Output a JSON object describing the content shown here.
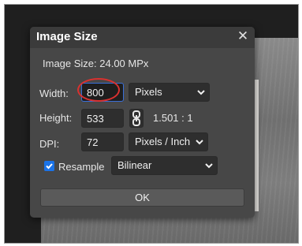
{
  "dialog": {
    "title": "Image Size",
    "close_symbol": "✕",
    "info": "Image Size: 24.00 MPx",
    "width": {
      "label": "Width:",
      "value": "800",
      "unit": "Pixels"
    },
    "height": {
      "label": "Height:",
      "value": "533",
      "ratio": "1.501 : 1"
    },
    "dpi": {
      "label": "DPI:",
      "value": "72",
      "unit": "Pixels / Inch"
    },
    "resample": {
      "label": "Resample",
      "checked": true,
      "method": "Bilinear"
    },
    "ok_label": "OK"
  },
  "icons": {
    "link": "chain-link-icon",
    "dropdown": "chevron-down-icon",
    "checkbox": "checkmark-icon"
  },
  "colors": {
    "dialog_bg": "#474747",
    "field_bg": "#2e2e2e",
    "focus_border": "#3a6fd8",
    "checkbox": "#1a73e8",
    "highlight_ring": "#d9312f"
  }
}
